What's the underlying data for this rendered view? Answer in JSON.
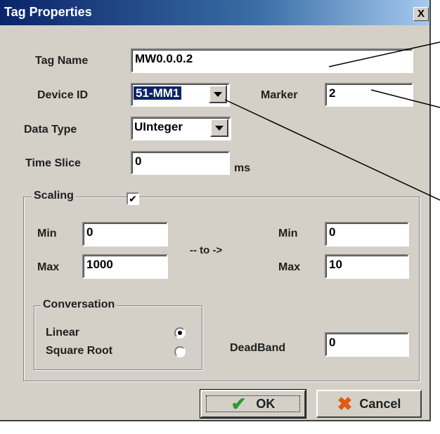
{
  "window": {
    "title": "Tag Properties",
    "close_label": "X"
  },
  "tag_name": {
    "label": "Tag Name",
    "value": "MW0.0.0.2"
  },
  "device_id": {
    "label": "Device ID",
    "value": "51-MM1"
  },
  "marker": {
    "label": "Marker",
    "value": "2"
  },
  "data_type": {
    "label": "Data Type",
    "value": "UInteger"
  },
  "time_slice": {
    "label": "Time Slice",
    "value": "0",
    "unit": "ms"
  },
  "scaling": {
    "label": "Scaling",
    "checked": true,
    "check_mark": "✔",
    "left_min_label": "Min",
    "left_min": "0",
    "left_max_label": "Max",
    "left_max": "1000",
    "to_label": "-- to ->",
    "right_min_label": "Min",
    "right_min": "0",
    "right_max_label": "Max",
    "right_max": "10",
    "conversation": {
      "label": "Conversation",
      "linear_label": "Linear",
      "square_root_label": "Square Root",
      "selected": "Linear"
    },
    "deadband_label": "DeadBand",
    "deadband": "0"
  },
  "buttons": {
    "ok_label": "OK",
    "ok_icon": "checkmark-icon",
    "cancel_label": "Cancel",
    "cancel_icon": "x-icon"
  },
  "colors": {
    "titlebar_start": "#0a246a",
    "dialog_bg": "#d4d0c8",
    "ok_icon": "#2a9a2a",
    "cancel_icon": "#e05a10"
  }
}
